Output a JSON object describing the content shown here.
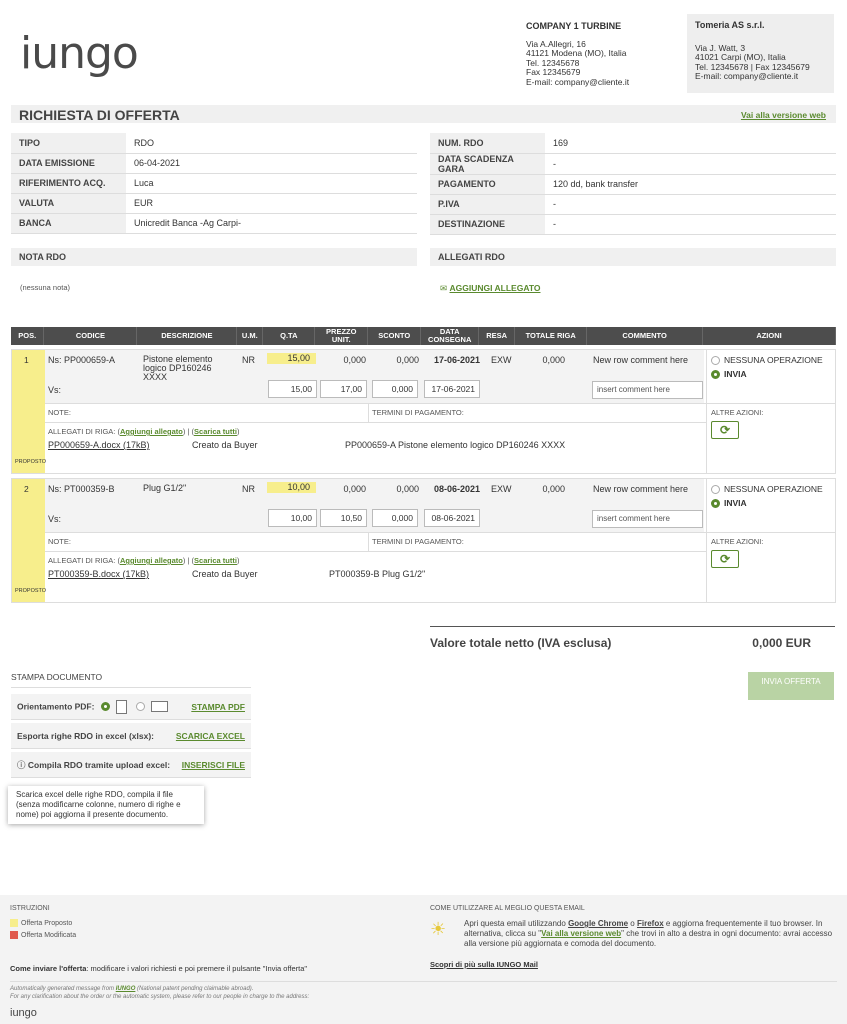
{
  "logo_text": "iungo",
  "sender": {
    "name": "COMPANY 1 TURBINE",
    "lines": [
      "Via A.Allegri, 16",
      "41121 Modena (MO), Italia",
      "Tel. 12345678",
      "Fax 12345679",
      "E-mail: company@cliente.it"
    ]
  },
  "recipient": {
    "name": "Tomeria AS s.r.l.",
    "lines": [
      "Via J. Watt, 3",
      "41021 Carpi (MO), Italia",
      "Tel. 12345678 | Fax 12345679",
      "E-mail: company@cliente.it"
    ]
  },
  "title": "RICHIESTA DI OFFERTA",
  "web_link": "Vai alla versione web",
  "info_left": [
    {
      "k": "TIPO",
      "v": "RDO"
    },
    {
      "k": "DATA EMISSIONE",
      "v": "06-04-2021"
    },
    {
      "k": "RIFERIMENTO ACQ.",
      "v": "Luca"
    },
    {
      "k": "VALUTA",
      "v": "EUR"
    },
    {
      "k": "BANCA",
      "v": "Unicredit Banca -Ag Carpi-"
    }
  ],
  "info_right": [
    {
      "k": "NUM. RDO",
      "v": "169"
    },
    {
      "k": "DATA SCADENZA GARA",
      "v": "-"
    },
    {
      "k": "PAGAMENTO",
      "v": "120 dd, bank transfer"
    },
    {
      "k": "P.IVA",
      "v": "-"
    },
    {
      "k": "DESTINAZIONE",
      "v": "-"
    }
  ],
  "nota_title": "NOTA RDO",
  "nota_text": "(nessuna nota)",
  "allegati_title": "ALLEGATI RDO",
  "add_attachment": "AGGIUNGI ALLEGATO",
  "columns": [
    "POS.",
    "CODICE",
    "DESCRIZIONE",
    "U.M.",
    "Q.TA",
    "PREZZO UNIT.",
    "SCONTO",
    "DATA CONSEGNA",
    "RESA",
    "TOTALE RIGA",
    "COMMENTO",
    "AZIONI"
  ],
  "rows": [
    {
      "pos": "1",
      "ns": "Ns: PP000659-A",
      "vs": "Vs:",
      "desc": "Pistone elemento logico DP160246 XXXX",
      "um": "NR",
      "qta": "15,00",
      "prezzo": "0,000",
      "sconto": "0,000",
      "data": "17-06-2021",
      "resa": "EXW",
      "totale": "0,000",
      "commento": "New row comment here",
      "in_qta": "15,00",
      "in_prezzo": "17,00",
      "in_sconto": "0,000",
      "in_data": "17-06-2021",
      "in_comment": "insert comment here",
      "opt1": "NESSUNA OPERAZIONE",
      "opt2": "INVIA",
      "note": "NOTE:",
      "termini": "TERMINI DI PAGAMENTO:",
      "altre": "ALTRE AZIONI:",
      "allegati_label": "ALLEGATI DI RIGA: (",
      "aggiungi": "Aggiungi allegato",
      "sep": ") | (",
      "scarica": "Scarica tutti",
      "close": ")",
      "file": "PP000659-A.docx  (17kB)",
      "creato": "Creato da Buyer",
      "file_desc": "PP000659-A Pistone elemento logico DP160246 XXXX",
      "status": "PROPOSTO"
    },
    {
      "pos": "2",
      "ns": "Ns: PT000359-B",
      "vs": "Vs:",
      "desc": "Plug G1/2\"",
      "um": "NR",
      "qta": "10,00",
      "prezzo": "0,000",
      "sconto": "0,000",
      "data": "08-06-2021",
      "resa": "EXW",
      "totale": "0,000",
      "commento": "New row comment here",
      "in_qta": "10,00",
      "in_prezzo": "10,50",
      "in_sconto": "0,000",
      "in_data": "08-06-2021",
      "in_comment": "insert comment here",
      "opt1": "NESSUNA OPERAZIONE",
      "opt2": "INVIA",
      "note": "NOTE:",
      "termini": "TERMINI DI PAGAMENTO:",
      "altre": "ALTRE AZIONI:",
      "allegati_label": "ALLEGATI DI RIGA: (",
      "aggiungi": "Aggiungi allegato",
      "sep": ") | (",
      "scarica": "Scarica tutti",
      "close": ")",
      "file": "PT000359-B.docx  (17kB)",
      "creato": "Creato da Buyer",
      "file_desc": "PT000359-B Plug G1/2\"",
      "status": "PROPOSTO"
    }
  ],
  "total_label": "Valore totale netto (IVA esclusa)",
  "total_value": "0,000 EUR",
  "stampa_title": "STAMPA DOCUMENTO",
  "orientamento": "Orientamento PDF:",
  "stampa_pdf": "STAMPA PDF",
  "esporta": "Esporta righe RDO in excel (xlsx):",
  "scarica_excel": "SCARICA EXCEL",
  "compila": "Compila RDO tramite upload excel:",
  "inserisci_file": "INSERISCI FILE",
  "tooltip": "Scarica excel delle righe RDO, compila il file (senza modificarne colonne, numero di righe e nome) poi aggiorna il presente documento.",
  "invia_offerta": "INVIA OFFERTA",
  "footer": {
    "istruzioni": "ISTRUZIONI",
    "legend1": "Offerta Proposto",
    "legend2": "Offerta Modificata",
    "legend1_color": "#f7ee8c",
    "legend2_color": "#e05a4e",
    "come_bold": "Come inviare l'offerta",
    "come_text": ": modificare i valori richiesti e poi premere il pulsante \"Invia offerta\"",
    "usage_title": "COME UTILIZZARE AL MEGLIO QUESTA EMAIL",
    "usage_p1": "Apri questa email utilizzando ",
    "chrome": "Google Chrome",
    "or": " o ",
    "firefox": "Firefox",
    "usage_p2": " e aggiorna frequentemente il tuo browser. In alternativa, clicca su \"",
    "web": "Vai alla versione web",
    "usage_p3": "\" che trovi in alto a destra in ogni documento: avrai accesso alla versione più aggiornata e comoda del documento.",
    "scopri": "Scopri di più sulla IUNGO Mail",
    "auto1a": "Automatically generated message from ",
    "auto1b": "IUNGO",
    "auto1c": " (National patent pending claimable abroad).",
    "auto2": "For any clarification about the order or the automatic system, please refer to our people in charge to the address:",
    "logo_small": "iungo"
  }
}
